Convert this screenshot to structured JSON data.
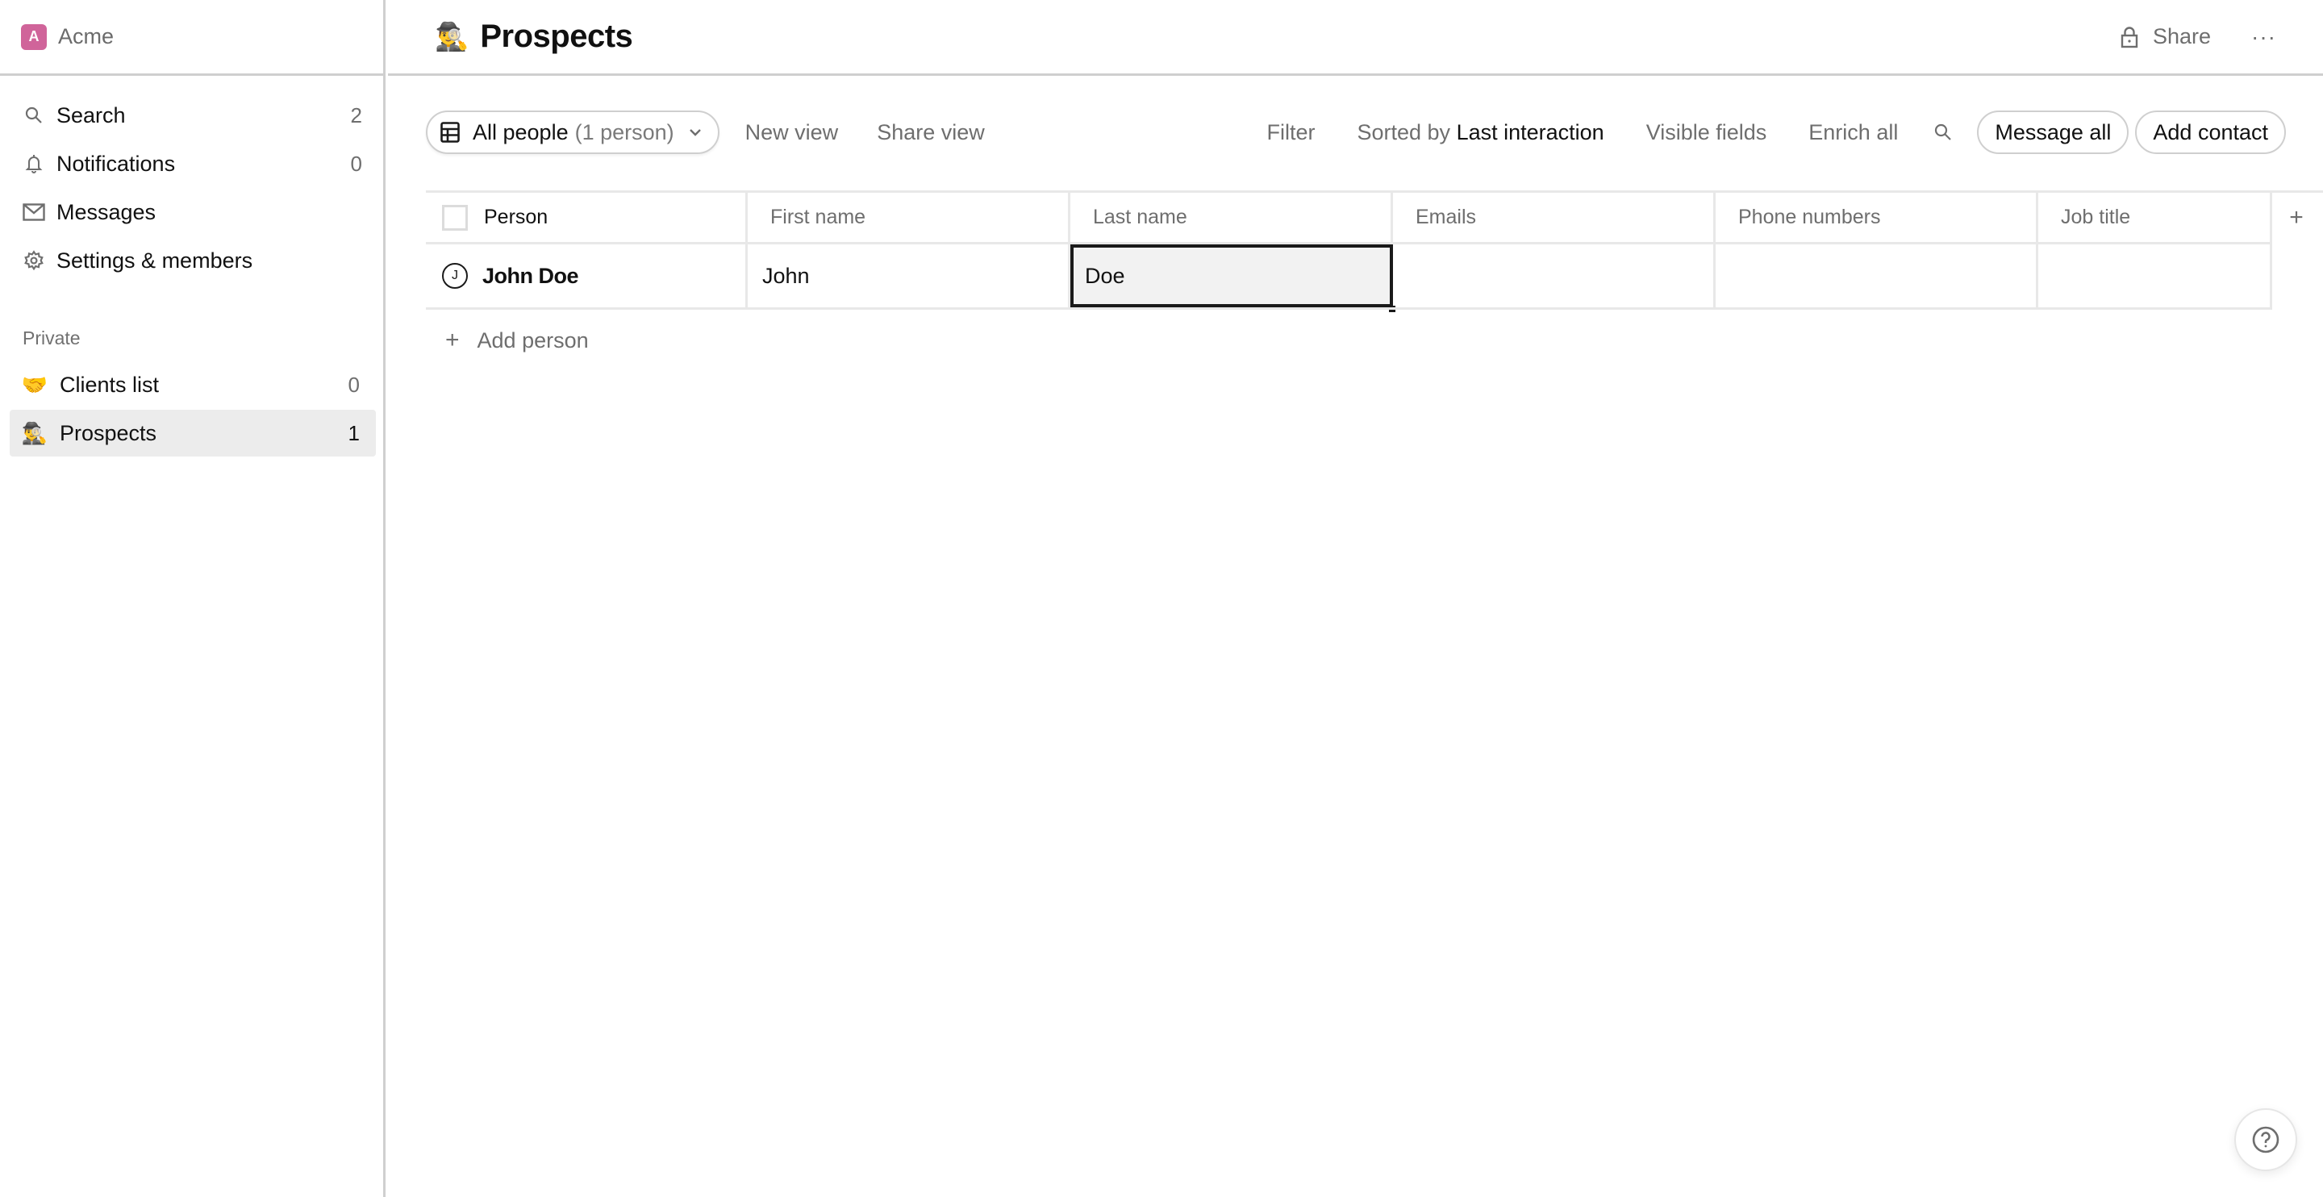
{
  "workspace": {
    "initial": "A",
    "name": "Acme",
    "avatar_color": "#d0649a"
  },
  "sidebar": {
    "nav": [
      {
        "label": "Search",
        "icon": "search-icon",
        "count": "2"
      },
      {
        "label": "Notifications",
        "icon": "bell-icon",
        "count": "0"
      },
      {
        "label": "Messages",
        "icon": "mail-icon",
        "count": ""
      },
      {
        "label": "Settings & members",
        "icon": "gear-icon",
        "count": ""
      }
    ],
    "section_label": "Private",
    "lists": [
      {
        "emoji": "🤝",
        "label": "Clients list",
        "count": "0",
        "active": false
      },
      {
        "emoji": "🕵️‍♂️",
        "label": "Prospects",
        "count": "1",
        "active": true
      }
    ]
  },
  "header": {
    "emoji": "🕵️‍♂️",
    "title": "Prospects",
    "share_label": "Share",
    "more_label": "···"
  },
  "toolbar": {
    "view_name": "All people",
    "view_count": "(1 person)",
    "new_view": "New view",
    "share_view": "Share view",
    "filter": "Filter",
    "sorted_prefix": "Sorted by",
    "sorted_field": "Last interaction",
    "visible_fields": "Visible fields",
    "enrich_all": "Enrich all",
    "message_all": "Message all",
    "add_contact": "Add contact"
  },
  "table": {
    "columns": [
      "Person",
      "First name",
      "Last name",
      "Emails",
      "Phone numbers",
      "Job title"
    ],
    "add_column_label": "+",
    "rows": [
      {
        "avatar_initial": "J",
        "person": "John Doe",
        "first_name": "John",
        "last_name": "Doe",
        "emails": "",
        "phone_numbers": "",
        "job_title": ""
      }
    ],
    "selected_cell": "Last name",
    "add_person_label": "Add person"
  },
  "help": {
    "icon": "help-icon"
  }
}
